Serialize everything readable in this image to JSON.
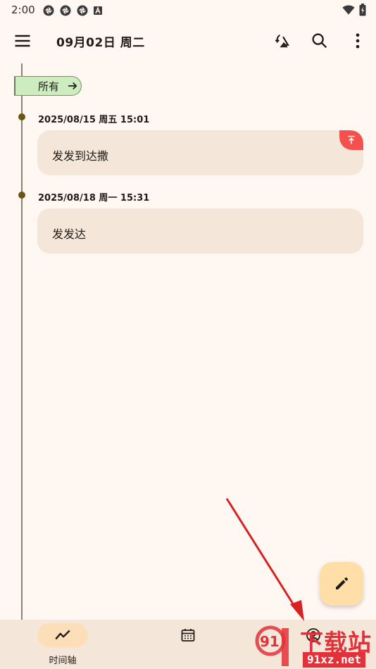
{
  "status_bar": {
    "time": "2:00",
    "left_icons": [
      "aperture-icon",
      "aperture-icon",
      "aperture-icon",
      "font-badge-icon"
    ],
    "right_icons": [
      "wifi-icon",
      "battery-icon"
    ]
  },
  "app_bar": {
    "title": "09月02日 周二",
    "menu_icon": "menu-icon",
    "actions": [
      "sync-icon",
      "search-icon",
      "more-vert-icon"
    ]
  },
  "filter": {
    "label": "所有",
    "icon": "arrow-right-icon"
  },
  "entries": [
    {
      "date": "2025/08/15 周五 15:01",
      "text": "发发到达撒",
      "pinned": true
    },
    {
      "date": "2025/08/18 周一 15:31",
      "text": "发发达",
      "pinned": false
    }
  ],
  "fab": {
    "icon": "edit-icon"
  },
  "bottom_nav": {
    "items": [
      {
        "label": "时间轴",
        "icon": "timeline-icon",
        "active": true
      },
      {
        "label": "",
        "icon": "calendar-icon",
        "active": false
      },
      {
        "label": "",
        "icon": "account-icon",
        "active": false
      }
    ]
  },
  "watermark": {
    "brand": "下载站",
    "site": "91xz.net",
    "logo_text": "91"
  },
  "colors": {
    "background": "#FFF7F2",
    "card": "#F4E7DA",
    "chip": "#CDECC0",
    "accent_fab": "#FFDEA8",
    "pin_red": "#F4514E",
    "timeline_dot": "#6B5416",
    "nav_active": "#FCDEB8",
    "annotation_arrow": "#D62222"
  }
}
